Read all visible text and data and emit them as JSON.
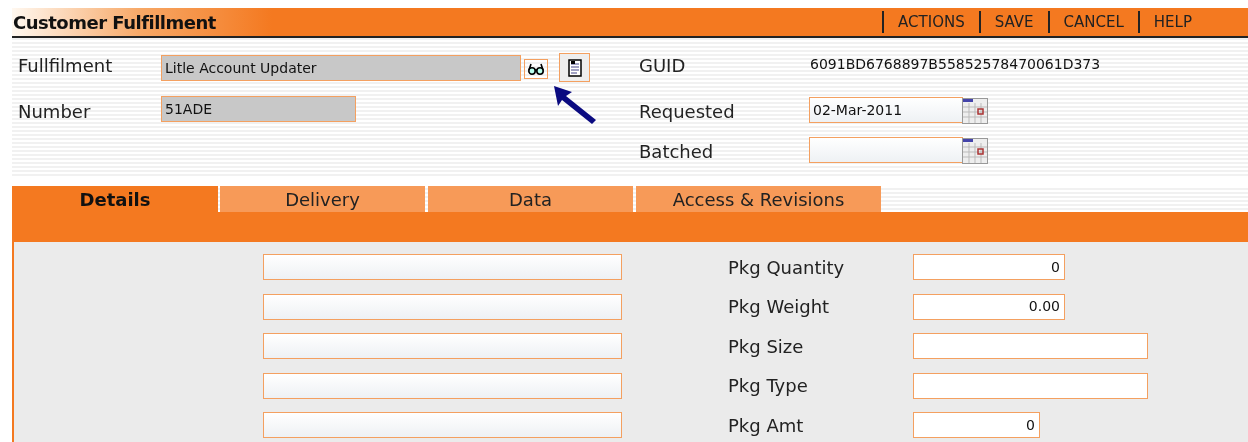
{
  "header": {
    "title": "Customer Fulfillment",
    "actions": [
      "ACTIONS",
      "SAVE",
      "CANCEL",
      "HELP"
    ]
  },
  "fullfilment": {
    "label": "Fullfilment",
    "value": "Litle Account Updater"
  },
  "number": {
    "label": "Number",
    "value": "51ADE"
  },
  "guid": {
    "label": "GUID",
    "value": "6091BD6768897B55852578470061D373"
  },
  "requested": {
    "label": "Requested",
    "value": "02-Mar-2011"
  },
  "batched": {
    "label": "Batched"
  },
  "tabs": [
    {
      "label": "Details",
      "selected": true
    },
    {
      "label": "Delivery",
      "selected": false
    },
    {
      "label": "Data",
      "selected": false
    },
    {
      "label": "Access & Revisions",
      "selected": false
    }
  ],
  "rows": [
    {
      "label": "Pkg Quantity",
      "value": "0",
      "kind": "number"
    },
    {
      "label": "Pkg Weight",
      "value": "0.00",
      "kind": "number"
    },
    {
      "label": "Pkg Size",
      "kind": "text"
    },
    {
      "label": "Pkg Type",
      "kind": "text"
    },
    {
      "label": "Pkg Amt",
      "value": "0",
      "kind": "amount"
    }
  ]
}
